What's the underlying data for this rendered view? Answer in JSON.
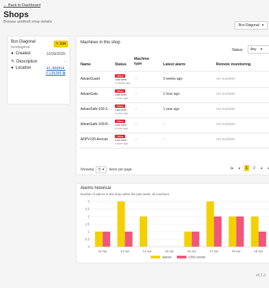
{
  "nav": {
    "back_label": "Back to Dashboard"
  },
  "page": {
    "title": "Shops",
    "subtitle": "Browse antitheft shop details"
  },
  "shop_selector": {
    "value": "Bcn Diagonal"
  },
  "shop": {
    "name": "Bcn Diagonal",
    "slug": "bcndiagonal",
    "edit_label": "Edit",
    "created_label": "Created",
    "created_value": "12/29/2020",
    "description_label": "Description",
    "description_value": "-",
    "location_label": "Location",
    "location_value_line1": "41.389804,",
    "location_value_line2": "2.135285"
  },
  "machines": {
    "title": "Machines in this shop",
    "status_label": "Status",
    "status_value": "Any",
    "headers": {
      "name": "Name",
      "status": "Status",
      "machine_type_line1": "Machine",
      "machine_type_line2": "type",
      "latest_alarm": "Latest alarm",
      "remote_monitoring": "Remote monitoring"
    },
    "rows": [
      {
        "name": "AdvanGuard",
        "status": "Offline",
        "last_seen_1": "Last seen",
        "last_seen_2": "2 weeks ago",
        "type": "-",
        "alarm": "3 weeks ago",
        "remote": "not available"
      },
      {
        "name": "AdvanGate",
        "status": "Offline",
        "last_seen_1": "Last seen",
        "last_seen_2": "1 hour ago",
        "type": "-",
        "alarm": "1 hour ago",
        "remote": "not available"
      },
      {
        "name": "AdvanSafe-100-3...",
        "status": "Offline",
        "last_seen_1": "Last seen",
        "last_seen_2": "a year ago",
        "type": "-",
        "alarm": "1 year ago",
        "remote": "not available"
      },
      {
        "name": "AdvanSafe-100-R...",
        "status": "Offline",
        "last_seen_1": "Last seen",
        "last_seen_2": "a year ago",
        "type": "-",
        "alarm": "-",
        "remote": "not available"
      },
      {
        "name": "ADPV120-Avocas",
        "status": "Offline",
        "last_seen_1": "Last seen",
        "last_seen_2": "a year ago",
        "type": "-",
        "alarm": "-",
        "remote": "not available"
      }
    ],
    "showing_label": "Showing",
    "per_page_value": "5",
    "per_page_suffix": "items per page",
    "pages": [
      "1",
      "2"
    ],
    "current_page": "1",
    "first_glyph": "|◂",
    "prev_glyph": "◂",
    "next_glyph": "▸",
    "last_glyph": "▸|"
  },
  "alarms": {
    "title": "Alarms historical",
    "subtitle": "Number of alarms in this shop within the past week, all machines"
  },
  "chart_data": {
    "type": "bar",
    "categories": [
      "12 Apr",
      "13 Apr",
      "14 Apr",
      "15 Apr",
      "16 Apr",
      "17 Apr",
      "18 Apr",
      "19 Apr"
    ],
    "series": [
      {
        "name": "alarms",
        "values": [
          1,
          3,
          2,
          0,
          1,
          3,
          2,
          2
        ],
        "color": "#f5d000"
      },
      {
        "name": "GRD events",
        "values": [
          1,
          1,
          0,
          0,
          1,
          2,
          2,
          1
        ],
        "color": "#f0577a"
      }
    ],
    "yticks": [
      "0",
      "0.5",
      "1",
      "1.5",
      "2",
      "2.5",
      "3"
    ],
    "ylim": [
      0,
      3
    ],
    "grid": true,
    "legend": "bottom"
  },
  "footer": {
    "version": "v0.2.3"
  },
  "colors": {
    "accent": "#f5d000",
    "offline": "#e0212f",
    "grd": "#f0577a",
    "link": "#1a5fb4"
  }
}
